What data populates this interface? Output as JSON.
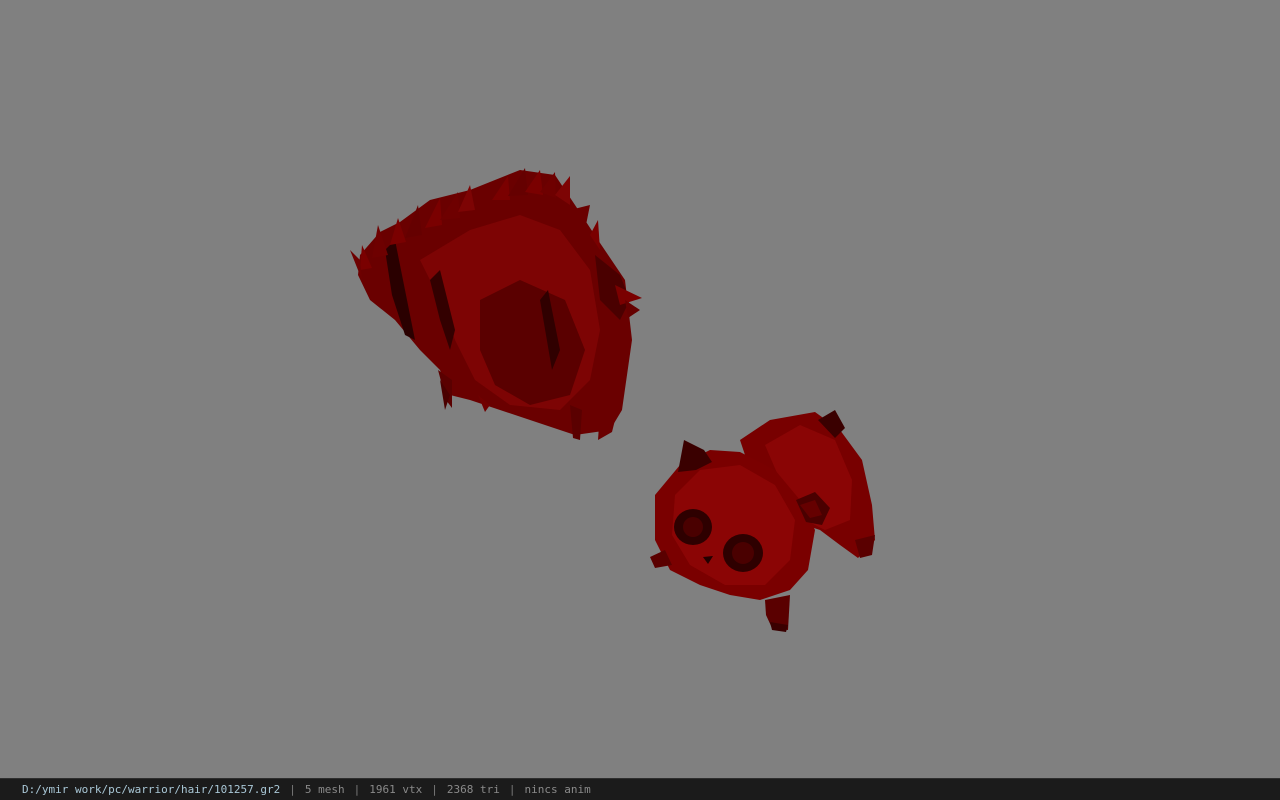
{
  "viewport": {
    "background_color": "#808080",
    "model_color": "#7a0000",
    "objects": [
      {
        "name": "hair-mesh",
        "icon": "spiky-hair-model"
      },
      {
        "name": "panda-accessory-mesh",
        "icon": "panda-model"
      }
    ]
  },
  "statusbar": {
    "file_path": "D:/ymir work/pc/warrior/hair/101257.gr2",
    "mesh_count": "5 mesh",
    "vertex_count": "1961 vtx",
    "triangle_count": "2368 tri",
    "anim_status": "nincs anim",
    "separator": "|",
    "path_color": "#a9c7d6"
  }
}
